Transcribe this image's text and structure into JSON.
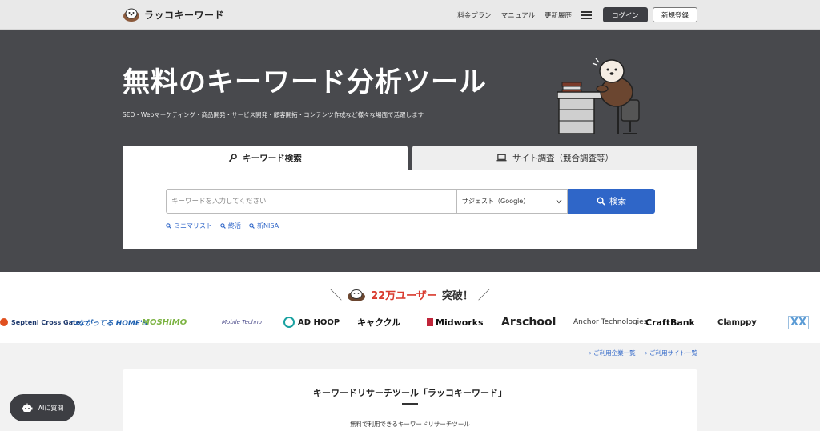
{
  "header": {
    "logo_text": "ラッコキーワード",
    "nav": [
      "料金プラン",
      "マニュアル",
      "更新履歴"
    ],
    "login_label": "ログイン",
    "register_label": "新規登録"
  },
  "hero": {
    "title": "無料のキーワード分析ツール",
    "subtitle": "SEO・Webマーケティング・商品開発・サービス開発・顧客開拓・コンテンツ作成など様々な場面で活躍します"
  },
  "search": {
    "tab_keyword": "キーワード検索",
    "tab_site": "サイト調査（競合調査等）",
    "placeholder": "キーワードを入力してください",
    "suggest_value": "サジェスト（Google）",
    "button_label": "検索",
    "quick_links": [
      "ミニマリスト",
      "終活",
      "新NISA"
    ]
  },
  "users": {
    "count": "22万ユーザー",
    "suffix": "突破！",
    "logos": [
      "Septeni Cross Gate",
      "つながってる HOME'S",
      "MOSHIMO",
      "Mobile Techno",
      "AD HOOP",
      "キャククル",
      "Midworks",
      "Arschool",
      "Anchor Technologies",
      "CraftBank",
      "Clamppy",
      "XX"
    ]
  },
  "links": [
    "ご利用企業一覧",
    "ご利用サイト一覧"
  ],
  "bottom": {
    "title": "キーワードリサーチツール「ラッコキーワード」",
    "desc": "無料で利用できるキーワードリサーチツール"
  },
  "ai_button": "AIに質問",
  "colors": {
    "accent": "#2f66c8",
    "hero_bg": "#48494d",
    "highlight": "#d93a2e"
  }
}
